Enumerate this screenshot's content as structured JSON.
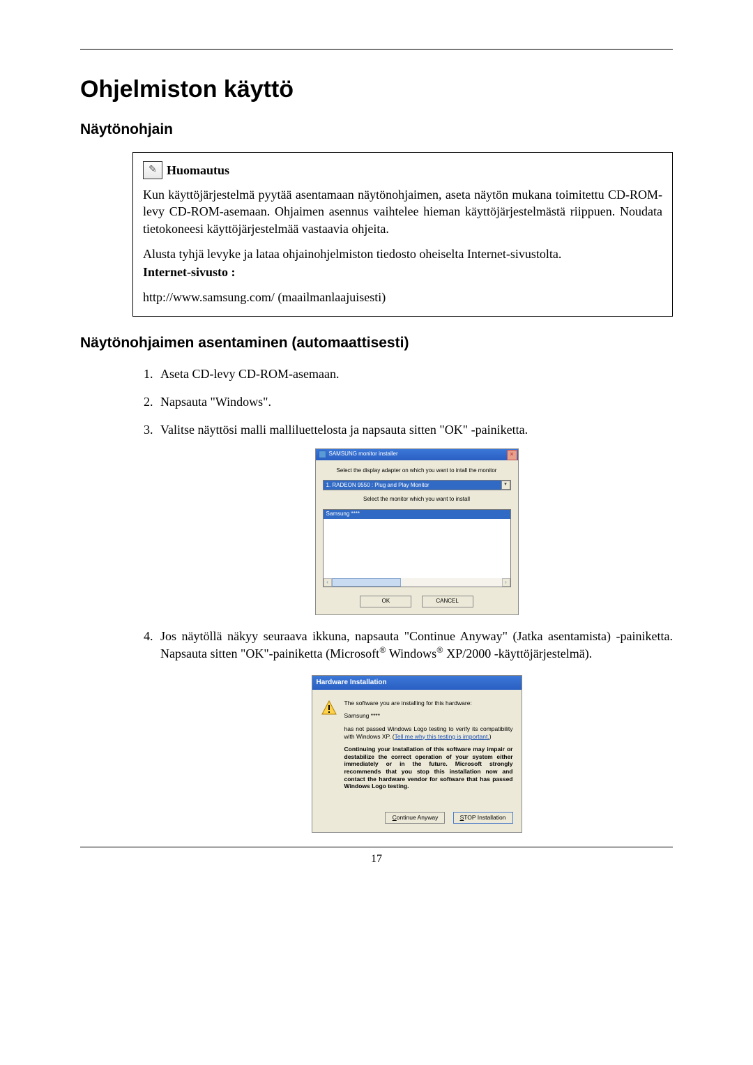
{
  "page_number": "17",
  "title": "Ohjelmiston käyttö",
  "section1_heading": "Näytönohjain",
  "note": {
    "label": "Huomautus",
    "para1": "Kun käyttöjärjestelmä pyytää asentamaan näytönohjaimen, aseta näytön mukana toimitettu CD-ROM-levy CD-ROM-asemaan. Ohjaimen asennus vaihtelee hieman käyttöjärjestelmästä riippuen. Noudata tietokoneesi käyttöjärjestelmää vastaavia ohjeita.",
    "para2": "Alusta tyhjä levyke ja lataa ohjainohjelmiston tiedosto oheiselta Internet-sivustolta.",
    "site_label": "Internet-sivusto :",
    "site_url": "http://www.samsung.com/ (maailmanlaajuisesti)"
  },
  "section2_heading": "Näytönohjaimen asentaminen (automaattisesti)",
  "steps": {
    "s1": "Aseta CD-levy CD-ROM-asemaan.",
    "s2": "Napsauta \"Windows\".",
    "s3": "Valitse näyttösi malli malliluettelosta ja napsauta sitten \"OK\" -painiketta.",
    "s4_a": "Jos näytöllä näkyy seuraava ikkuna, napsauta \"Continue Anyway\" (Jatka asentamista) -painiketta. Napsauta sitten \"OK\"-painiketta (Microsoft",
    "s4_b": " Windows",
    "s4_c": " XP/2000 -käyttöjärjestelmä)."
  },
  "installer_dialog": {
    "title": "SAMSUNG monitor installer",
    "instr1": "Select the display adapter on which you want to intall the monitor",
    "combo_value": "1. RADEON 9550 : Plug and Play Monitor",
    "instr2": "Select the monitor which you want to install",
    "list_item": "Samsung ****",
    "ok": "OK",
    "cancel": "CANCEL"
  },
  "hw_dialog": {
    "title": "Hardware Installation",
    "line1": "The software you are installing for this hardware:",
    "line2": "Samsung ****",
    "line3_a": "has not passed Windows Logo testing to verify its compatibility with Windows XP. (",
    "line3_link": "Tell me why this testing is important.",
    "line3_b": ")",
    "bold_block": "Continuing your installation of this software may impair or destabilize the correct operation of your system either immediately or in the future. Microsoft strongly recommends that you stop this installation now and contact the hardware vendor for software that has passed Windows Logo testing.",
    "btn_continue_pre": "C",
    "btn_continue_rest": "ontinue Anyway",
    "btn_stop_pre": "S",
    "btn_stop_rest": "TOP Installation"
  }
}
